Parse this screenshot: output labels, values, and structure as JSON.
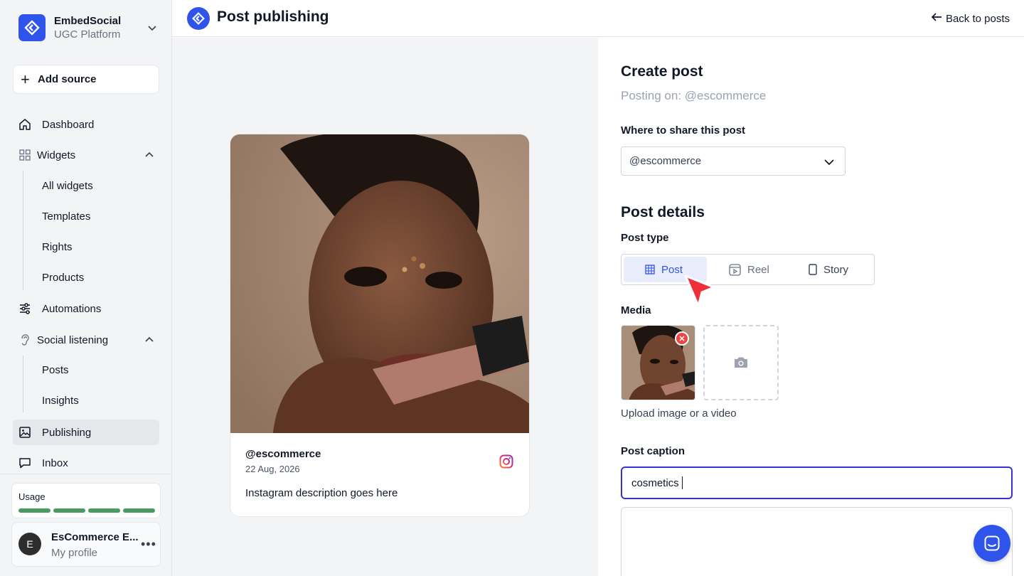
{
  "brand": {
    "name": "EmbedSocial",
    "subtitle": "UGC Platform"
  },
  "sidebar": {
    "add_source": "Add source",
    "items": [
      {
        "label": "Dashboard",
        "icon": "home-icon"
      },
      {
        "label": "Widgets",
        "icon": "grid-icon",
        "expanded": true,
        "children": [
          "All widgets",
          "Templates",
          "Rights",
          "Products"
        ]
      },
      {
        "label": "Automations",
        "icon": "automation-icon"
      },
      {
        "label": "Social listening",
        "icon": "ear-icon",
        "expanded": true,
        "children": [
          "Posts",
          "Insights"
        ]
      },
      {
        "label": "Publishing",
        "icon": "image-icon",
        "active": true
      },
      {
        "label": "Inbox",
        "icon": "chat-bubble-icon"
      }
    ],
    "usage_label": "Usage",
    "usage_segments": 4,
    "profile": {
      "initial": "E",
      "name": "EsCommerce E...",
      "subtitle": "My profile",
      "more": "•••"
    }
  },
  "header": {
    "title": "Post publishing",
    "back": "Back to posts"
  },
  "preview": {
    "username": "@escommerce",
    "date": "22 Aug, 2026",
    "description": "Instagram description goes here",
    "network_icon": "instagram-icon"
  },
  "form": {
    "title": "Create post",
    "posting_on": "Posting on: @escommerce",
    "share_label": "Where to share this post",
    "share_value": "@escommerce",
    "details_title": "Post details",
    "post_type_label": "Post type",
    "post_types": [
      {
        "label": "Post",
        "icon": "grid-icon",
        "selected": true
      },
      {
        "label": "Reel",
        "icon": "reel-icon",
        "selected": false
      },
      {
        "label": "Story",
        "icon": "story-icon",
        "selected": false
      }
    ],
    "media_label": "Media",
    "upload_hint": "Upload image or a video",
    "caption_label": "Post caption",
    "caption_value": "cosmetics"
  },
  "colors": {
    "accent": "#2f54eb",
    "focus": "#3b2fd6",
    "usage": "#4b9a5f",
    "remove": "#ef4444",
    "cursor": "#ef2f3a"
  }
}
